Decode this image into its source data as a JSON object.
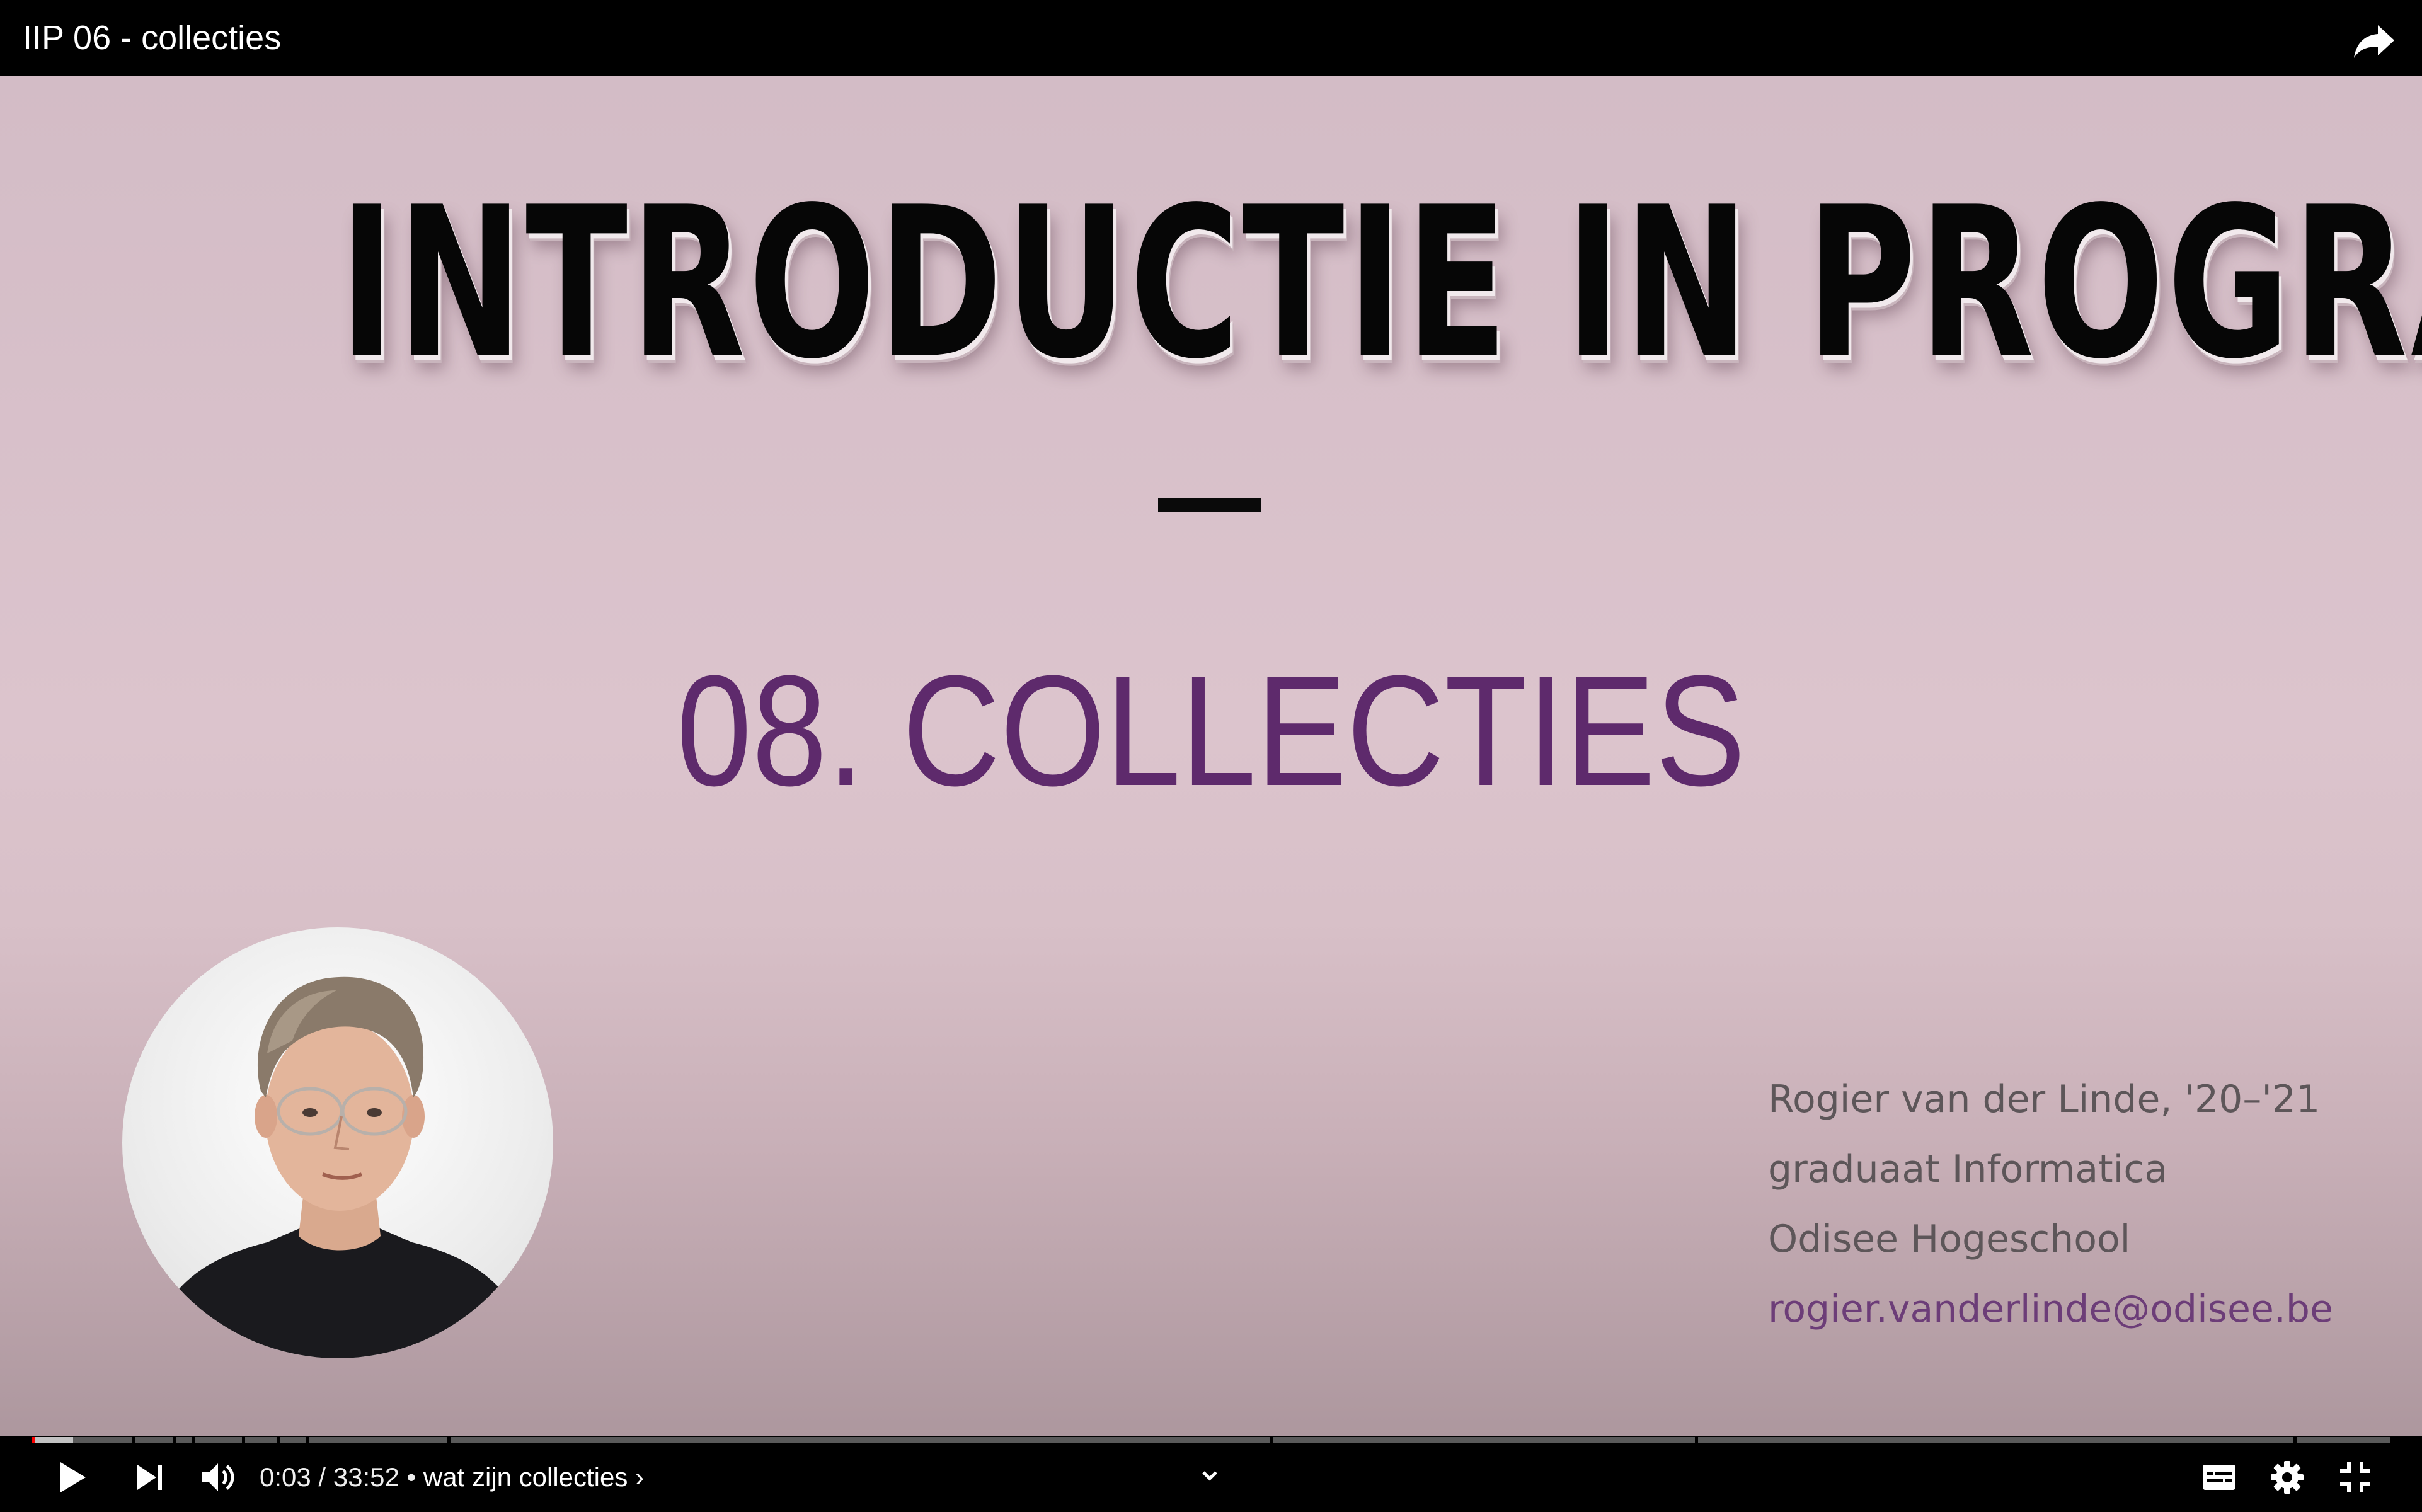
{
  "window": {
    "title": "IIP 06 - collecties"
  },
  "slide": {
    "heading": "INTRODUCTIE IN PROGRAMMEREN",
    "subtitle": "08. COLLECTIES",
    "author_lines": [
      "Rogier van der Linde, '20–'21",
      "graduaat Informatica",
      "Odisee Hogeschool"
    ],
    "email": "rogier.vanderlinde@odisee.be"
  },
  "player": {
    "current_time": "0:03",
    "separator": " / ",
    "duration": "33:52",
    "bullet": " • ",
    "chapter": "wat zijn collecties",
    "chapter_chevron": "›",
    "progress_fraction": 0.0015,
    "accent_color": "#ff0000",
    "icons": {
      "share": "share-icon",
      "play": "play-icon",
      "next": "next-icon",
      "volume": "volume-icon",
      "expand": "chevron-down-icon",
      "subtitles": "subtitles-icon",
      "settings": "gear-icon",
      "exit_fullscreen": "exit-fullscreen-icon"
    }
  }
}
